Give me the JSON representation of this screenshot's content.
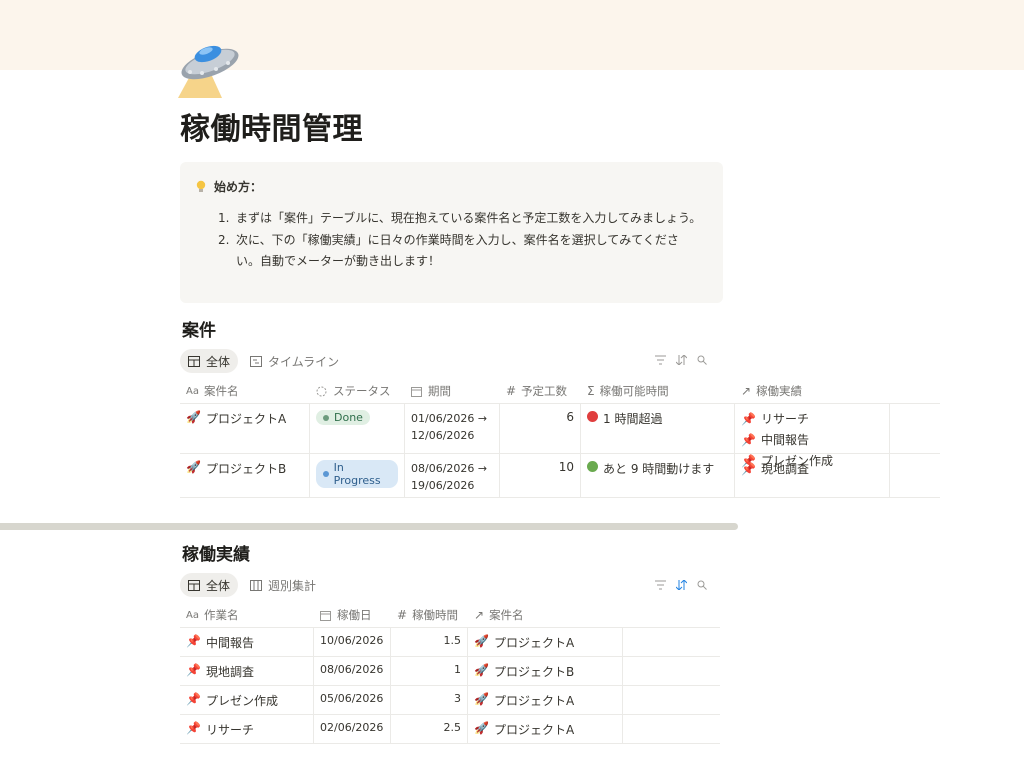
{
  "page": {
    "title": "稼働時間管理",
    "icon": "ufo-icon"
  },
  "callout": {
    "heading": "始め方：",
    "steps": [
      {
        "num": "1.",
        "text": "まずは「案件」テーブルに、現在抱えている案件名と予定工数を入力してみましょう。"
      },
      {
        "num": "2.",
        "text": "次に、下の「稼働実績」に日々の作業時間を入力し、案件名を選択してみてください。自動でメーターが動き出します！"
      }
    ]
  },
  "projects": {
    "title": "案件",
    "tabs": [
      "全体",
      "タイムライン"
    ],
    "columns": [
      "案件名",
      "ステータス",
      "期間",
      "予定工数",
      "稼働可能時間",
      "稼働実績"
    ],
    "rows": [
      {
        "name": "プロジェクトA",
        "status": "Done",
        "period_start": "01/06/2026 →",
        "period_end": "12/06/2026",
        "planned": "6",
        "capacity": "1 時間超過",
        "capacity_color": "#e03e3e",
        "actuals": [
          "リサーチ",
          "中間報告",
          "プレゼン作成"
        ]
      },
      {
        "name": "プロジェクトB",
        "status": "In Progress",
        "period_start": "08/06/2026 →",
        "period_end": "19/06/2026",
        "planned": "10",
        "capacity": "あと 9 時間動けます",
        "capacity_color": "#6aaa4f",
        "actuals": [
          "現地調査"
        ]
      }
    ]
  },
  "worklog": {
    "title": "稼働実績",
    "tabs": [
      "全体",
      "週別集計"
    ],
    "columns": [
      "作業名",
      "稼働日",
      "稼働時間",
      "案件名"
    ],
    "rows": [
      {
        "name": "中間報告",
        "date": "10/06/2026",
        "hours": "1.5",
        "project": "プロジェクトA"
      },
      {
        "name": "現地調査",
        "date": "08/06/2026",
        "hours": "1",
        "project": "プロジェクトB"
      },
      {
        "name": "プレゼン作成",
        "date": "05/06/2026",
        "hours": "3",
        "project": "プロジェクトA"
      },
      {
        "name": "リサーチ",
        "date": "02/06/2026",
        "hours": "2.5",
        "project": "プロジェクトA"
      }
    ]
  },
  "colors": {
    "cover": "#fcf5ec",
    "done_tag": "#e0efe3",
    "progress_tag": "#d9e8f6",
    "over": "#e03e3e",
    "ok": "#6aaa4f"
  }
}
